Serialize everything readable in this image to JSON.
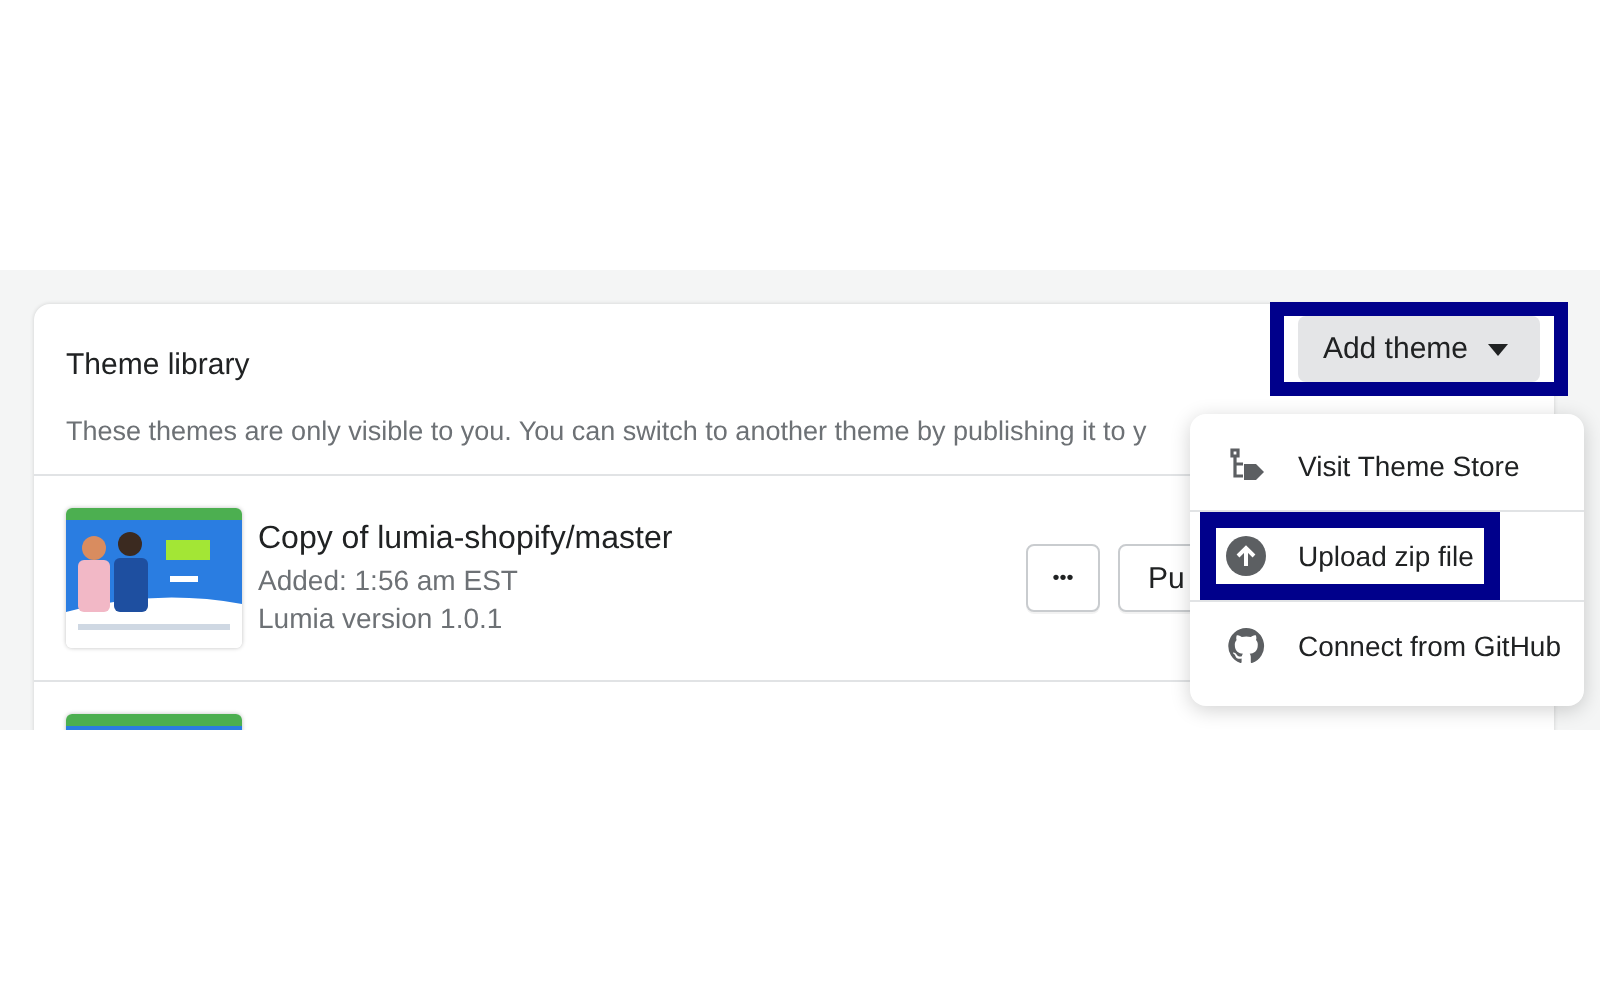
{
  "card": {
    "title": "Theme library",
    "description": "These themes are only visible to you. You can switch to another theme by publishing it to y",
    "add_button": {
      "label": "Add theme",
      "highlighted": true
    },
    "themes": [
      {
        "kind": "theme",
        "name": "Copy of lumia-shopify/master",
        "added": "Added: 1:56 am EST",
        "version": "Lumia version 1.0.1",
        "more": "•••",
        "publish": "Pu"
      },
      {
        "kind": "picture"
      }
    ]
  },
  "menu": {
    "items": [
      {
        "kind": "store",
        "label": "Visit Theme Store",
        "highlighted": false
      },
      {
        "kind": "upload",
        "label": "Upload zip file",
        "highlighted": true
      },
      {
        "kind": "github",
        "label": "Connect from GitHub",
        "highlighted": false
      }
    ]
  }
}
